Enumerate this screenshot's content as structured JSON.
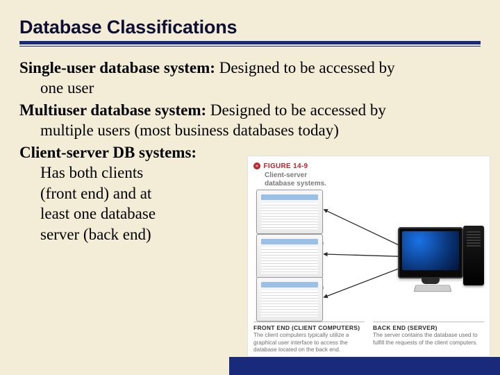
{
  "title": "Database Classifications",
  "entries": [
    {
      "term": "Single-user database system:",
      "desc_inline": " Designed to be accessed by",
      "desc_cont": "one user"
    },
    {
      "term": "Multiuser database system:",
      "desc_inline": " Designed to be accessed by",
      "desc_cont": "multiple users (most business databases today)"
    },
    {
      "term": "Client-server DB systems:",
      "desc_inline": "",
      "desc_lines": [
        "Has both clients",
        "(front end) and at",
        "least one database",
        "server (back end)"
      ]
    }
  ],
  "figure": {
    "bullet_glyph": "»",
    "number": "FIGURE 14-9",
    "subtitle_l1": "Client-server",
    "subtitle_l2": "database systems.",
    "front": {
      "head": "FRONT END (CLIENT COMPUTERS)",
      "body": "The client computers typically utilize a graphical user interface to access the database located on the back end."
    },
    "back": {
      "head": "BACK END (SERVER)",
      "body": "The server contains the database used to fulfill the requests of the client computers."
    }
  }
}
